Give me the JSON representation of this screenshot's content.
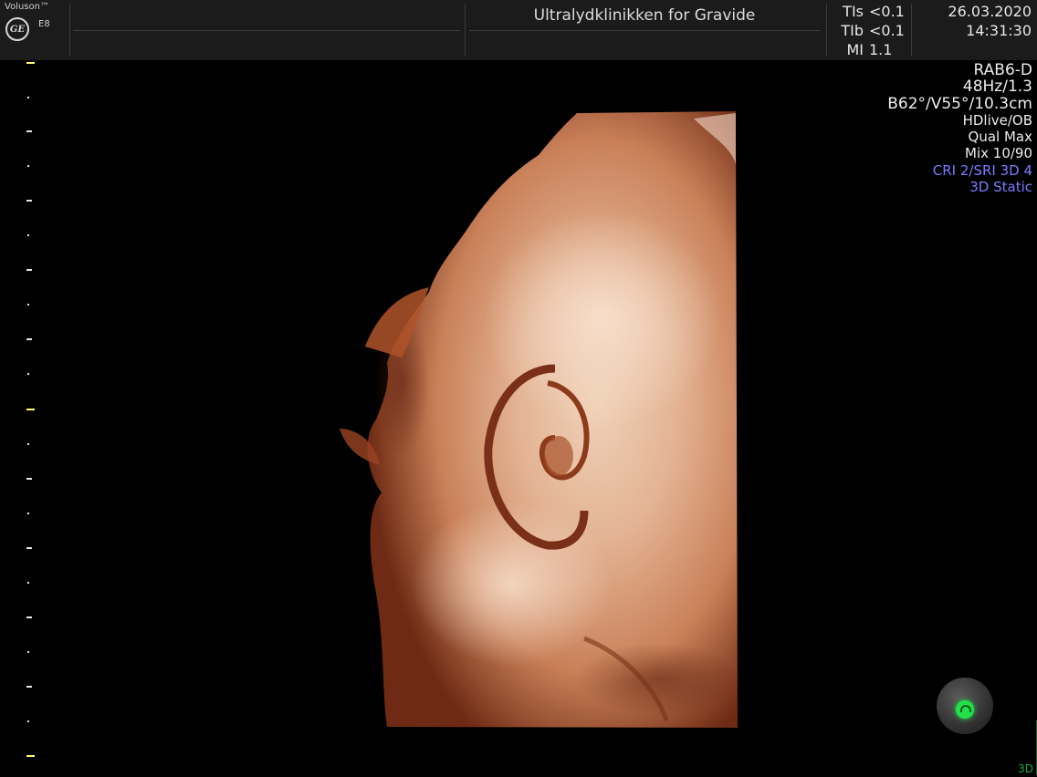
{
  "header": {
    "brand": "Voluson™",
    "logo_text": "GE",
    "model": "E8",
    "clinic_name": "Ultralydklinikken for Gravide",
    "indices": [
      {
        "label": "TIs",
        "value": "<0.1"
      },
      {
        "label": "TIb",
        "value": "<0.1"
      },
      {
        "label": "MI",
        "value": "1.1"
      }
    ],
    "date": "26.03.2020",
    "time": "14:31:30"
  },
  "params": {
    "probe": "RAB6-D",
    "frame_rate": "48Hz/1.3",
    "geometry": "B62°/V55°/10.3cm",
    "render_mode": "HDlive/OB",
    "quality": "Qual Max",
    "mix": "Mix 10/90",
    "cri_sri": "CRI 2/SRI 3D 4",
    "mode": "3D Static"
  },
  "colors": {
    "accent_blue": "#7b7bff",
    "tick_yellow": "#ffff6a",
    "status_green": "#22e04a",
    "skin_base": "#c98058"
  },
  "status": {
    "icon": "status-indicator-icon"
  },
  "footer": {
    "mode_label": "3D"
  }
}
